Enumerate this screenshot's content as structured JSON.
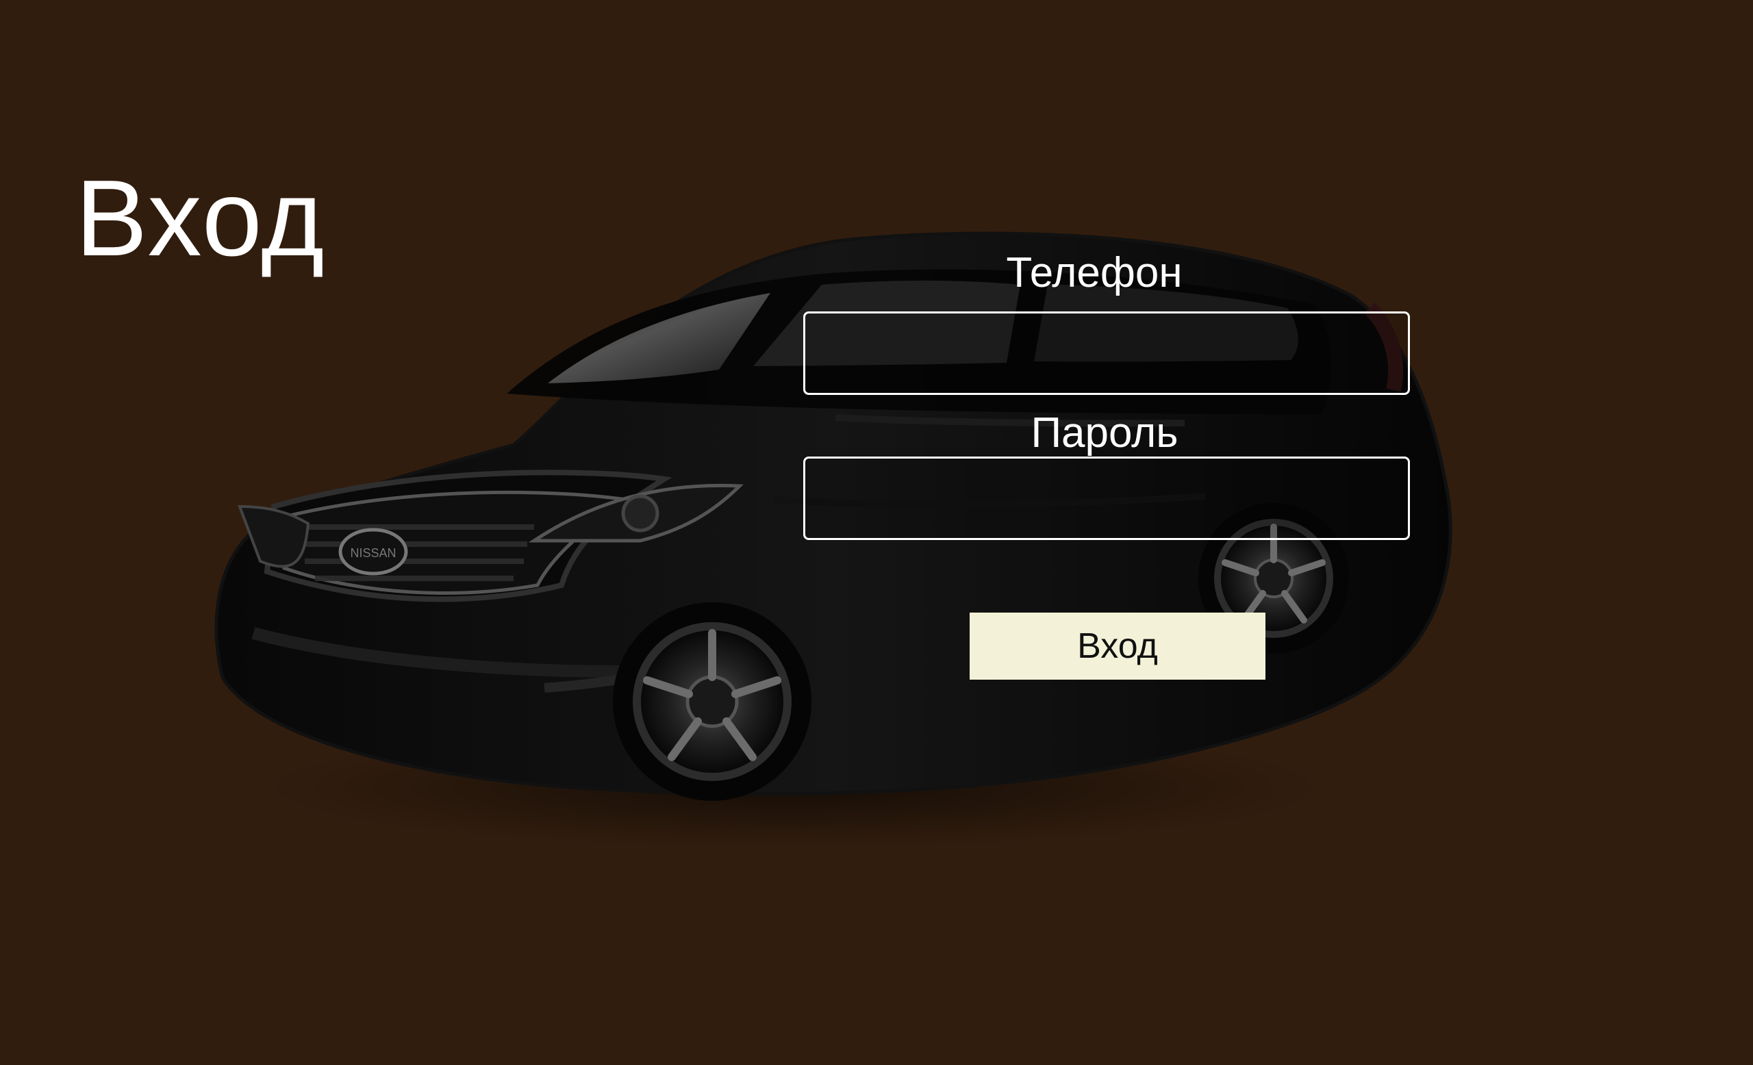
{
  "header": {
    "title": "Вход"
  },
  "form": {
    "phone_label": "Телефон",
    "phone_value": "",
    "password_label": "Пароль",
    "password_value": "",
    "submit_label": "Вход"
  },
  "background": {
    "image": "car-image",
    "color": "#311d0e"
  },
  "colors": {
    "text": "#ffffff",
    "button_background": "#f3f2d8",
    "button_text": "#111111"
  }
}
